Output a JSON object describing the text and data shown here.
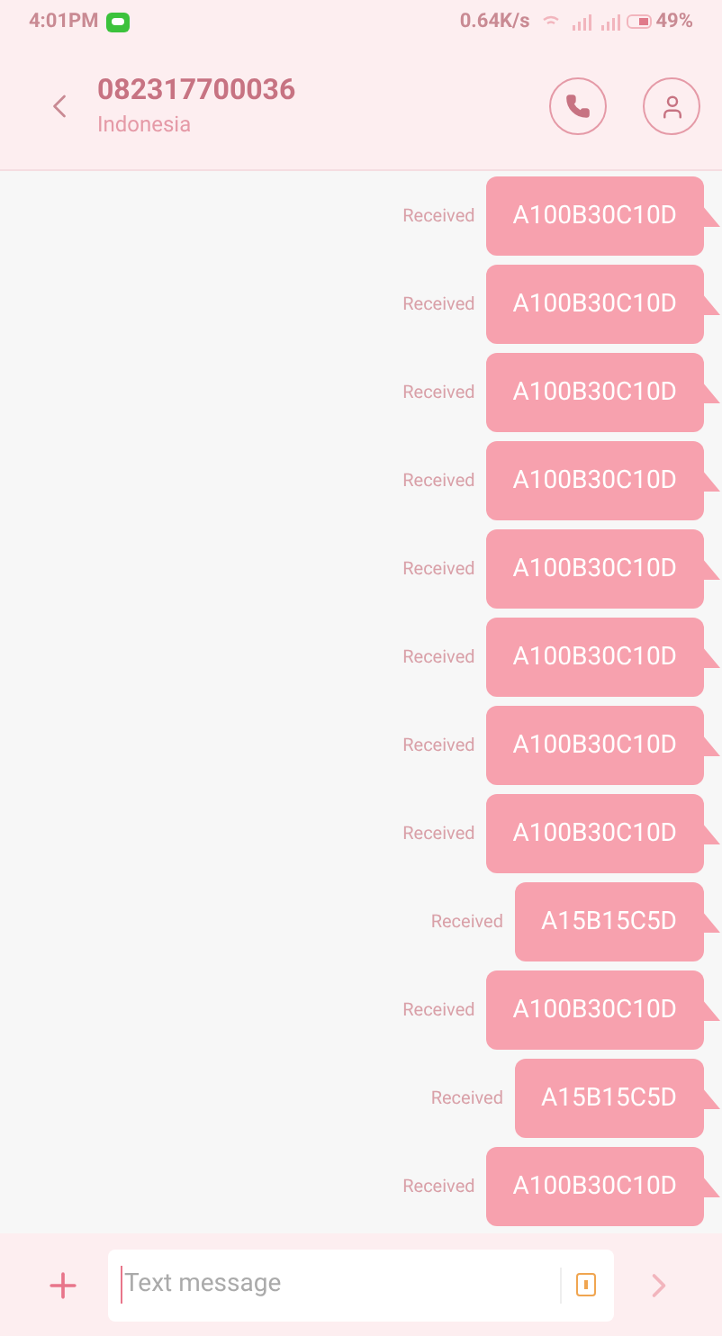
{
  "status_bar": {
    "time": "4:01PM",
    "speed": "0.64K/s",
    "battery": "49%"
  },
  "header": {
    "title": "082317700036",
    "subtitle": "Indonesia"
  },
  "messages": [
    {
      "status": "Received",
      "text": "A100B30C10D"
    },
    {
      "status": "Received",
      "text": "A100B30C10D"
    },
    {
      "status": "Received",
      "text": "A100B30C10D"
    },
    {
      "status": "Received",
      "text": "A100B30C10D"
    },
    {
      "status": "Received",
      "text": "A100B30C10D"
    },
    {
      "status": "Received",
      "text": "A100B30C10D"
    },
    {
      "status": "Received",
      "text": "A100B30C10D"
    },
    {
      "status": "Received",
      "text": "A100B30C10D"
    },
    {
      "status": "Received",
      "text": "A15B15C5D"
    },
    {
      "status": "Received",
      "text": "A100B30C10D"
    },
    {
      "status": "Received",
      "text": "A15B15C5D"
    },
    {
      "status": "Received",
      "text": "A100B30C10D"
    }
  ],
  "composer": {
    "placeholder": "Text message"
  }
}
